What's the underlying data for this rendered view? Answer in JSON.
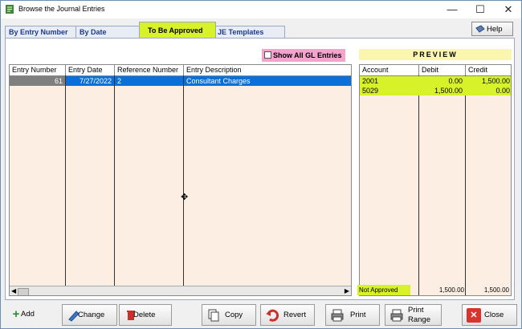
{
  "window": {
    "title": "Browse the Journal Entries",
    "controls": {
      "minimize": "—",
      "maximize": "☐",
      "close": "✕"
    }
  },
  "tabs": [
    {
      "label": "By Entry Number"
    },
    {
      "label": "By Date"
    },
    {
      "label": "To Be Approved",
      "active": true
    },
    {
      "label": "JE Templates"
    }
  ],
  "help": {
    "label": "Help"
  },
  "show_all": {
    "label": "Show All GL Entries",
    "checked": false
  },
  "grid": {
    "columns": [
      "Entry Number",
      "Entry Date",
      "Reference Number",
      "Entry Description"
    ],
    "rows": [
      {
        "entry_number": "61",
        "entry_date": "7/27/2022",
        "reference": "2",
        "description": "Consultant Charges"
      }
    ]
  },
  "preview": {
    "title": "PREVIEW",
    "columns": [
      "Account",
      "Debit",
      "Credit"
    ],
    "rows": [
      {
        "account": "2001",
        "debit": "0.00",
        "credit": "1,500.00"
      },
      {
        "account": "5029",
        "debit": "1,500.00",
        "credit": "0.00"
      }
    ],
    "status": "Not Approved",
    "total_debit": "1,500.00",
    "total_credit": "1,500.00"
  },
  "buttons": {
    "add": "Add",
    "change": "Change",
    "delete": "Delete",
    "copy": "Copy",
    "revert": "Revert",
    "print": "Print",
    "print_range": "Print Range",
    "close": "Close"
  },
  "colors": {
    "highlight": "#d7f229",
    "grid_bg": "#fdeee4",
    "selected_row": "#0a6fd6",
    "show_all_bg": "#f4a3cf"
  }
}
